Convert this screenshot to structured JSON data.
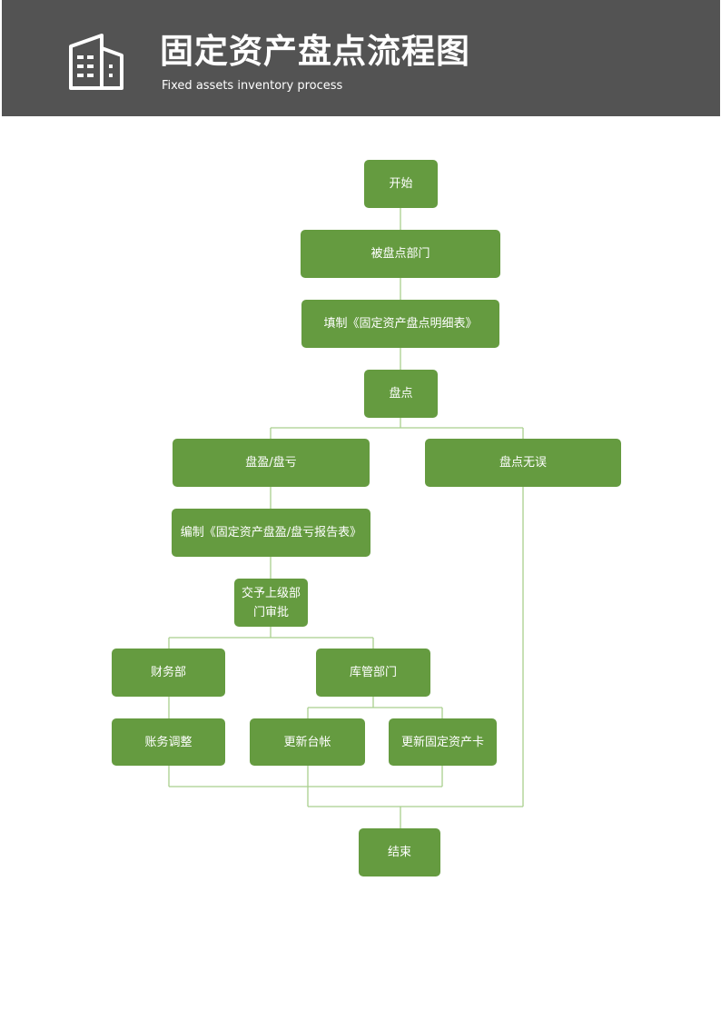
{
  "header": {
    "title": "固定资产盘点流程图",
    "subtitle": "Fixed assets inventory process",
    "icon": "building-icon",
    "background_color": "#535353"
  },
  "flowchart": {
    "node_color": "#659b40",
    "connector_color": "#a9cf8d",
    "nodes": {
      "start": "开始",
      "audited_dept": "被盘点部门",
      "fill_detail_form": "填制《固定资产盘点明细表》",
      "inventory": "盘点",
      "surplus_deficit": "盘盈/盘亏",
      "no_error": "盘点无误",
      "compile_report": "编制《固定资产盘盈/盘亏报告表》",
      "submit_approval_line1": "交予上级部",
      "submit_approval_line2": "门审批",
      "finance_dept": "财务部",
      "warehouse_dept": "库管部门",
      "account_adjust": "账务调整",
      "update_ledger": "更新台帐",
      "update_asset_card": "更新固定资产卡",
      "end": "结束"
    }
  }
}
